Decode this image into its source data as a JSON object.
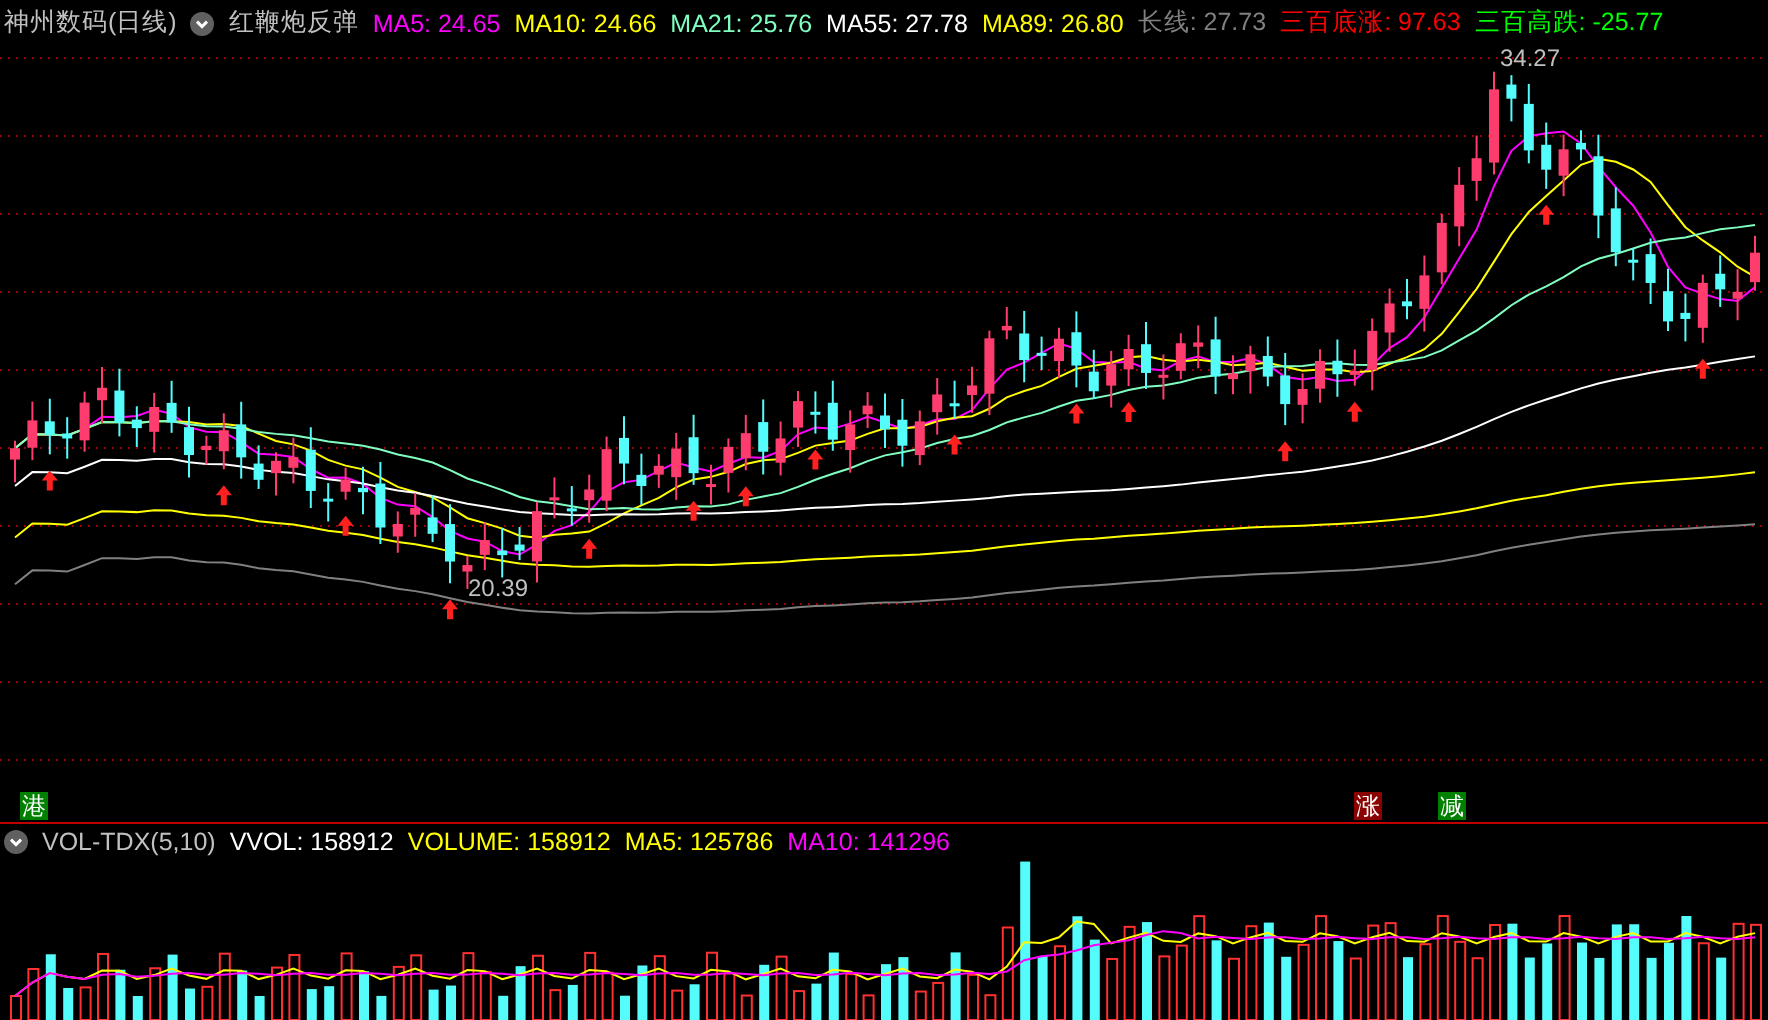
{
  "header": {
    "title": "神州数码(日线)",
    "indicator": "红鞭炮反弹",
    "items": [
      {
        "label": "MA5:",
        "value": "24.65",
        "color": "#ff00ff"
      },
      {
        "label": "MA10:",
        "value": "24.66",
        "color": "#ffff00"
      },
      {
        "label": "MA21:",
        "value": "25.76",
        "color": "#80ffc0"
      },
      {
        "label": "MA55:",
        "value": "27.78",
        "color": "#ffffff"
      },
      {
        "label": "MA89:",
        "value": "26.80",
        "color": "#ffff00"
      },
      {
        "label": "长线:",
        "value": "27.73",
        "color": "#808080"
      },
      {
        "label": "三百底涨:",
        "value": "97.63",
        "color": "#ff0000"
      },
      {
        "label": "三百高跌:",
        "value": "-25.77",
        "color": "#00ff00"
      }
    ]
  },
  "price_labels": [
    {
      "text": "34.27"
    },
    {
      "text": "20.39"
    }
  ],
  "markers": [
    {
      "text": "港",
      "color": "#008000"
    },
    {
      "text": "涨",
      "color": "#8b0000"
    },
    {
      "text": "减",
      "color": "#008000"
    }
  ],
  "volume_header": {
    "title": "VOL-TDX(5,10)",
    "items": [
      {
        "label": "VVOL:",
        "value": "158912",
        "color": "#ffffff"
      },
      {
        "label": "VOLUME:",
        "value": "158912",
        "color": "#ffff00"
      },
      {
        "label": "MA5:",
        "value": "125786",
        "color": "#ffff00"
      },
      {
        "label": "MA10:",
        "value": "141296",
        "color": "#ff00ff"
      }
    ]
  }
}
